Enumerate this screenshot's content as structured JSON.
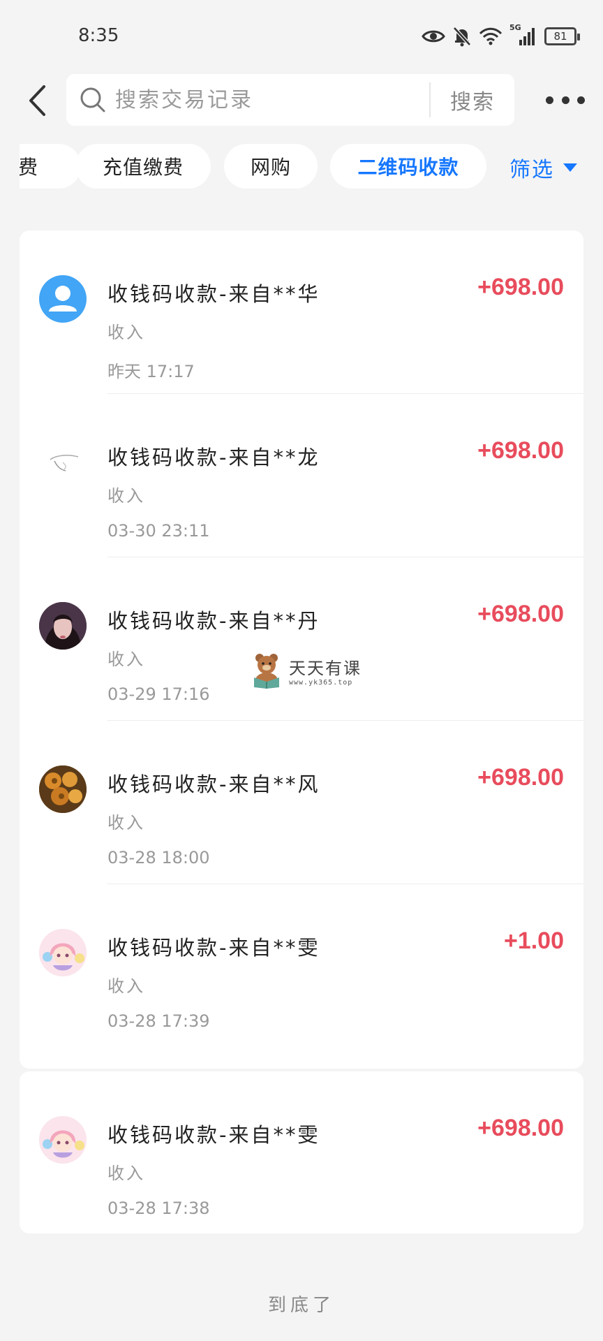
{
  "status_bar": {
    "time": "8:35",
    "network": "5G",
    "battery": "81"
  },
  "header": {
    "search_placeholder": "搜索交易记录",
    "search_button": "搜索"
  },
  "tabs": [
    {
      "label": "费",
      "active": false
    },
    {
      "label": "充值缴费",
      "active": false
    },
    {
      "label": "网购",
      "active": false
    },
    {
      "label": "二维码收款",
      "active": true
    }
  ],
  "filter": {
    "label": "筛选"
  },
  "colors": {
    "accent": "#1677ff",
    "amount": "#e84c5c",
    "background": "#f4f4f4"
  },
  "transactions": [
    {
      "title": "收钱码收款-来自**华",
      "type": "收入",
      "time": "昨天 17:17",
      "amount": "+698.00",
      "avatar": "default-user-avatar"
    },
    {
      "title": "收钱码收款-来自**龙",
      "type": "收入",
      "time": "03-30 23:11",
      "amount": "+698.00",
      "avatar": "sketch-avatar"
    },
    {
      "title": "收钱码收款-来自**丹",
      "type": "收入",
      "time": "03-29 17:16",
      "amount": "+698.00",
      "avatar": "girl-photo-avatar"
    },
    {
      "title": "收钱码收款-来自**风",
      "type": "收入",
      "time": "03-28 18:00",
      "amount": "+698.00",
      "avatar": "food-photo-avatar"
    },
    {
      "title": "收钱码收款-来自**雯",
      "type": "收入",
      "time": "03-28 17:39",
      "amount": "+1.00",
      "avatar": "anime-girl-avatar"
    },
    {
      "title": "收钱码收款-来自**雯",
      "type": "收入",
      "time": "03-28 17:38",
      "amount": "+698.00",
      "avatar": "anime-girl-avatar"
    }
  ],
  "watermark": {
    "name": "天天有课",
    "url": "www.yk365.top"
  },
  "footer": {
    "text": "到底了"
  }
}
